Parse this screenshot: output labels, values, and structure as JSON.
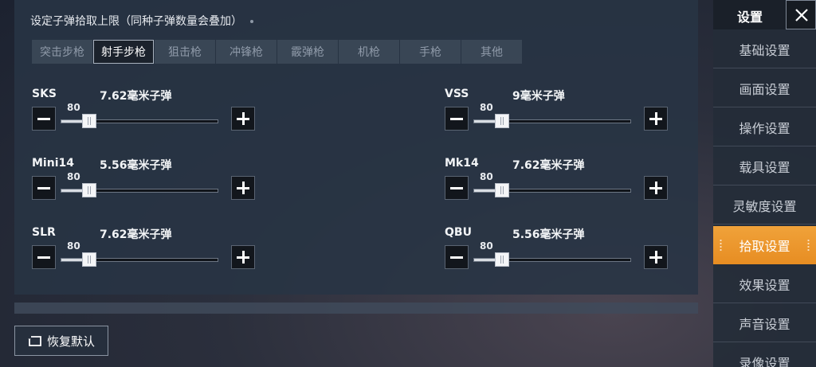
{
  "section": {
    "title": "设定子弹拾取上限（同种子弹数量会叠加）"
  },
  "tabs": [
    {
      "label": "突击步枪",
      "active": false
    },
    {
      "label": "射手步枪",
      "active": true
    },
    {
      "label": "狙击枪",
      "active": false
    },
    {
      "label": "冲锋枪",
      "active": false
    },
    {
      "label": "霰弹枪",
      "active": false
    },
    {
      "label": "机枪",
      "active": false
    },
    {
      "label": "手枪",
      "active": false
    },
    {
      "label": "其他",
      "active": false
    }
  ],
  "weapons": [
    {
      "name": "SKS",
      "ammo": "7.62毫米子弹",
      "value": "80",
      "fraction": 0.18
    },
    {
      "name": "VSS",
      "ammo": "9毫米子弹",
      "value": "80",
      "fraction": 0.18
    },
    {
      "name": "Mini14",
      "ammo": "5.56毫米子弹",
      "value": "80",
      "fraction": 0.18
    },
    {
      "name": "Mk14",
      "ammo": "7.62毫米子弹",
      "value": "80",
      "fraction": 0.18
    },
    {
      "name": "SLR",
      "ammo": "7.62毫米子弹",
      "value": "80",
      "fraction": 0.18
    },
    {
      "name": "QBU",
      "ammo": "5.56毫米子弹",
      "value": "80",
      "fraction": 0.18
    }
  ],
  "reset": {
    "label": "恢复默认"
  },
  "sidebar": {
    "title": "设置",
    "items": [
      {
        "label": "基础设置",
        "active": false
      },
      {
        "label": "画面设置",
        "active": false
      },
      {
        "label": "操作设置",
        "active": false
      },
      {
        "label": "载具设置",
        "active": false
      },
      {
        "label": "灵敏度设置",
        "active": false
      },
      {
        "label": "拾取设置",
        "active": true
      },
      {
        "label": "效果设置",
        "active": false
      },
      {
        "label": "声音设置",
        "active": false
      },
      {
        "label": "录像设置",
        "active": false
      }
    ]
  },
  "colors": {
    "accent": "#e98f24",
    "panel": "#283444"
  }
}
